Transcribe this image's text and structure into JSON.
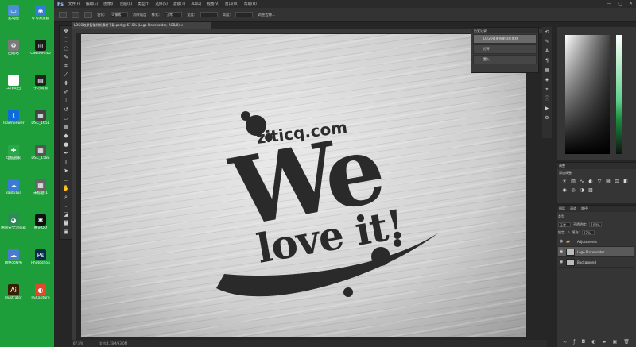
{
  "desktop": {
    "icons": [
      {
        "label": "此电脑",
        "glyph": "▭",
        "color": "#4a90d9"
      },
      {
        "label": "Q Q浏览器",
        "glyph": "◉",
        "color": "#2f7ed8"
      },
      {
        "label": "回收站",
        "glyph": "♻",
        "color": "#7a7a7a"
      },
      {
        "label": "CINEMA 4D",
        "glyph": "◎",
        "color": "#1b1b1b"
      },
      {
        "label": "工作文档",
        "glyph": "▤",
        "color": "#ffffff"
      },
      {
        "label": "学习资源",
        "glyph": "▤",
        "color": "#222222"
      },
      {
        "label": "TeamViewer",
        "glyph": "t",
        "color": "#0e6bd7"
      },
      {
        "label": "DSC_1651",
        "glyph": "▦",
        "color": "#444444"
      },
      {
        "label": "电脑管家",
        "glyph": "✚",
        "color": "#2aa84a"
      },
      {
        "label": "DSC_1585",
        "glyph": "▦",
        "color": "#555555"
      },
      {
        "label": "BaiduYun",
        "glyph": "☁",
        "color": "#3b7bd8"
      },
      {
        "label": "未标题-1",
        "glyph": "▦",
        "color": "#666666"
      },
      {
        "label": "腾讯安全浏览器",
        "glyph": "◕",
        "color": "#2e8b57"
      },
      {
        "label": "腾讯QQ",
        "glyph": "✱",
        "color": "#111111"
      },
      {
        "label": "网络云服务",
        "glyph": "☁",
        "color": "#4a7bd0"
      },
      {
        "label": "Photoshop",
        "glyph": "Ps",
        "color": "#0a2a4a"
      },
      {
        "label": "Illustrator",
        "glyph": "Ai",
        "color": "#3a1e00"
      },
      {
        "label": "FSCapture",
        "glyph": "◐",
        "color": "#e04a2a"
      }
    ]
  },
  "menubar": {
    "logo": "Ps",
    "items": [
      "文件(F)",
      "编辑(E)",
      "图像(I)",
      "图层(L)",
      "类型(Y)",
      "选择(S)",
      "滤镜(T)",
      "3D(D)",
      "视图(V)",
      "窗口(W)",
      "帮助(H)"
    ],
    "minimize": "—",
    "maximize": "▢",
    "close": "✕"
  },
  "optionsbar": {
    "style_label": "羽化:",
    "feather_value": "0 像素",
    "antialias_label": "消除锯齿",
    "style2_label": "样式:",
    "style2_value": "正常",
    "width_label": "宽度:",
    "height_label": "高度:",
    "refine_label": "调整边缘..."
  },
  "document": {
    "tab_title": "LOGO效果智能样机素材下载.psd @ 67.5% (Logo Placeholder, RGB/8) ×",
    "zoom": "67.5%",
    "doc_info": "文档:4.78M/93.0M"
  },
  "canvas": {
    "site": "ziticq.com",
    "headline": "We",
    "subline": "love it!"
  },
  "history_panel": {
    "title": "历史记录",
    "rows": [
      "LOGO效果智能样机素材",
      "打开",
      "置入"
    ]
  },
  "adjustments_panel": {
    "title": "调整",
    "subtitle": "添加调整"
  },
  "layers_panel": {
    "tabs": [
      "图层",
      "通道",
      "路径"
    ],
    "kind_label": "类型",
    "blend_mode": "正常",
    "opacity_label": "不透明度:",
    "opacity_value": "100%",
    "lock_label": "锁定:",
    "fill_label": "填充:",
    "fill_value": "27%",
    "layers": [
      {
        "name": "Adjustments",
        "type": "folder",
        "selected": false
      },
      {
        "name": "Logo Placeholder",
        "type": "smart",
        "selected": true
      },
      {
        "name": "Background",
        "type": "image",
        "selected": false
      }
    ]
  }
}
